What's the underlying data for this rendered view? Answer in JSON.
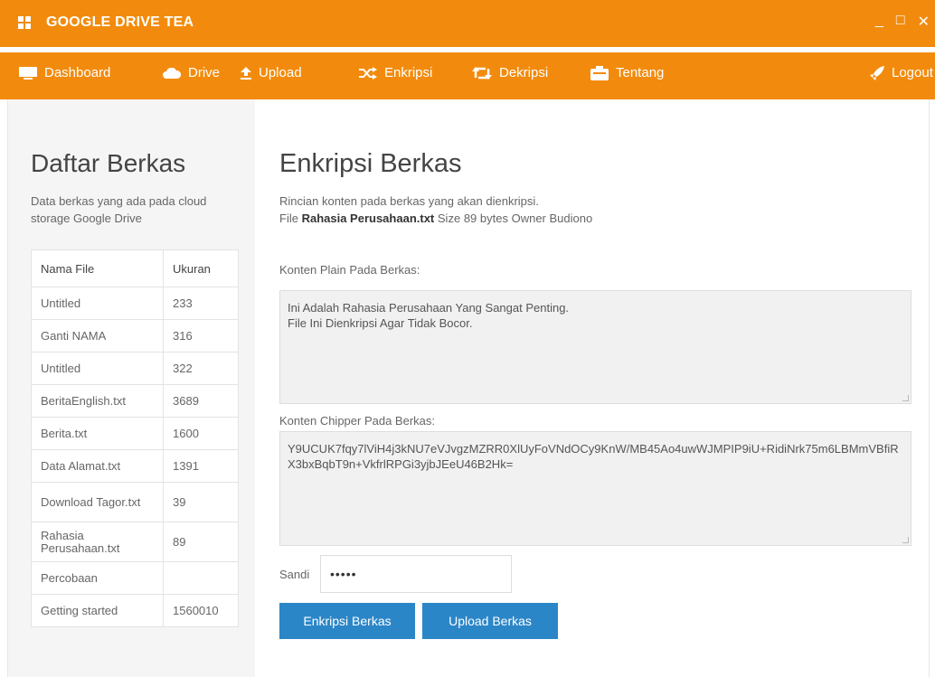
{
  "app": {
    "title": "GOOGLE DRIVE TEA",
    "controls": {
      "minimize": "_",
      "maximize": "□",
      "close": "✕"
    }
  },
  "nav": {
    "items": [
      {
        "label": "Dashboard",
        "icon": "dashboard-icon"
      },
      {
        "label": "Drive",
        "icon": "cloud-icon"
      },
      {
        "label": "Upload",
        "icon": "upload-icon"
      },
      {
        "label": "Enkripsi",
        "icon": "shuffle-icon"
      },
      {
        "label": "Dekripsi",
        "icon": "retweet-icon"
      },
      {
        "label": "Tentang",
        "icon": "info-icon"
      }
    ],
    "logout": {
      "label": "Logout",
      "icon": "rocket-icon"
    }
  },
  "sidebar": {
    "title": "Daftar Berkas",
    "description": "Data berkas yang ada pada cloud storage Google Drive",
    "table": {
      "headers": [
        "Nama File",
        "Ukuran"
      ],
      "rows": [
        {
          "name": "Untitled",
          "size": "233"
        },
        {
          "name": "Ganti NAMA",
          "size": "316"
        },
        {
          "name": "Untitled",
          "size": "322"
        },
        {
          "name": "BeritaEnglish.txt",
          "size": "3689"
        },
        {
          "name": "Berita.txt",
          "size": "1600"
        },
        {
          "name": "Data Alamat.txt",
          "size": "1391"
        },
        {
          "name": "Download Tagor.txt",
          "size": "39"
        },
        {
          "name": "Rahasia Perusahaan.txt",
          "size": "89"
        },
        {
          "name": "Percobaan",
          "size": ""
        },
        {
          "name": "Getting started",
          "size": "1560010"
        }
      ]
    }
  },
  "main": {
    "title": "Enkripsi Berkas",
    "description": "Rincian konten pada berkas yang akan dienkripsi.",
    "file_info": {
      "prefix": "File",
      "filename": "Rahasia Perusahaan.txt",
      "size_label": "Size",
      "size_value": "89 bytes",
      "owner_label": "Owner",
      "owner_value": "Budiono"
    },
    "plain_label": "Konten Plain Pada Berkas:",
    "plain_line1": "Ini Adalah Rahasia Perusahaan Yang Sangat Penting.",
    "plain_line2": "File Ini Dienkripsi Agar Tidak Bocor.",
    "cipher_label": "Konten Chipper Pada Berkas:",
    "cipher_text": "Y9UCUK7fqy7lViH4j3kNU7eVJvgzMZRR0XlUyFoVNdOCy9KnW/MB45Ao4uwWJMPIP9iU+RidiNrk75m6LBMmVBfiRX3bxBqbT9n+VkfrlRPGi3yjbJEeU46B2Hk=",
    "password_label": "Sandi",
    "password_value": "•••••",
    "encrypt_button": "Enkripsi Berkas",
    "upload_button": "Upload Berkas"
  },
  "colors": {
    "accent": "#f28b0d",
    "button": "#2b86c8",
    "sidebar_bg": "#f5f5f5",
    "textarea_bg": "#f1f1f1"
  }
}
